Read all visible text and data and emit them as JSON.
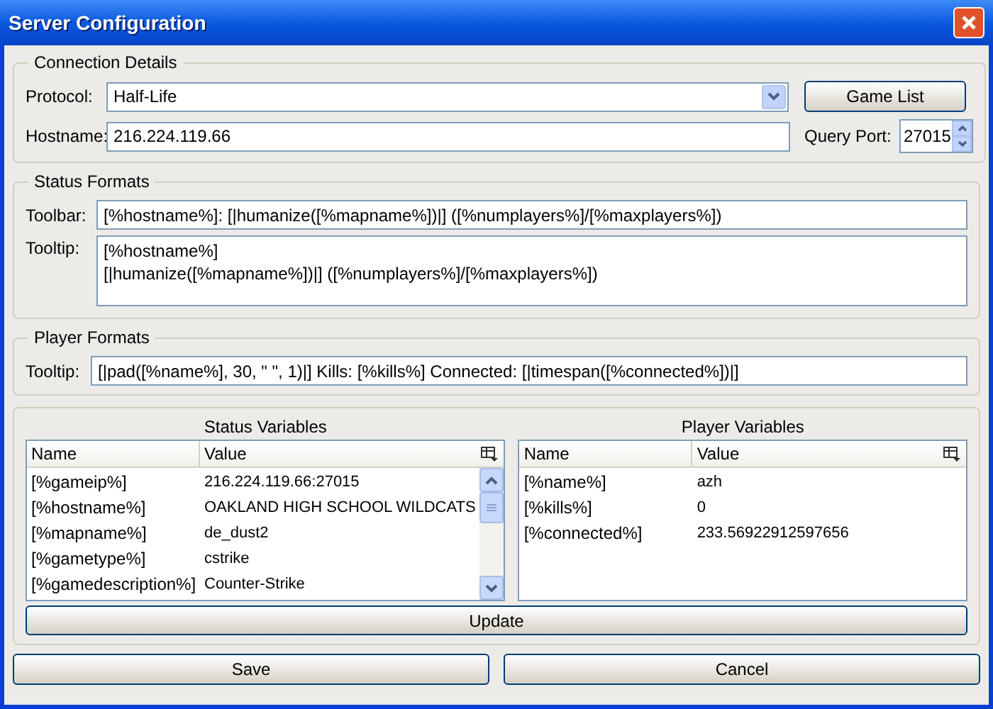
{
  "window": {
    "title": "Server Configuration"
  },
  "connection_details": {
    "title": "Connection Details",
    "protocol": {
      "label": "Protocol:",
      "value": "Half-Life"
    },
    "game_list_button": "Game List",
    "hostname": {
      "label": "Hostname:",
      "value": "216.224.119.66"
    },
    "query_port": {
      "label": "Query Port:",
      "value": "27015"
    }
  },
  "status_formats": {
    "title": "Status Formats",
    "toolbar": {
      "label": "Toolbar:",
      "value": "[%hostname%]: [|humanize([%mapname%])|] ([%numplayers%]/[%maxplayers%])"
    },
    "tooltip": {
      "label": "Tooltip:",
      "value": "[%hostname%]\n[|humanize([%mapname%])|] ([%numplayers%]/[%maxplayers%])"
    }
  },
  "player_formats": {
    "title": "Player Formats",
    "tooltip": {
      "label": "Tooltip:",
      "value": "[|pad([%name%], 30, \" \", 1)|] Kills: [%kills%] Connected: [|timespan([%connected%])|]"
    }
  },
  "status_variables": {
    "title": "Status Variables",
    "columns": [
      "Name",
      "Value"
    ],
    "rows": [
      {
        "name": "[%gameip%]",
        "value": "216.224.119.66:27015"
      },
      {
        "name": "[%hostname%]",
        "value": "OAKLAND HIGH SCHOOL WILDCATS"
      },
      {
        "name": "[%mapname%]",
        "value": "de_dust2"
      },
      {
        "name": "[%gametype%]",
        "value": "cstrike"
      },
      {
        "name": "[%gamedescription%]",
        "value": "Counter-Strike"
      }
    ]
  },
  "player_variables": {
    "title": "Player Variables",
    "columns": [
      "Name",
      "Value"
    ],
    "rows": [
      {
        "name": "[%name%]",
        "value": "azh"
      },
      {
        "name": "[%kills%]",
        "value": "0"
      },
      {
        "name": "[%connected%]",
        "value": "233.56922912597656"
      }
    ]
  },
  "update_button": "Update",
  "buttons": [
    "Save",
    "Cancel"
  ]
}
